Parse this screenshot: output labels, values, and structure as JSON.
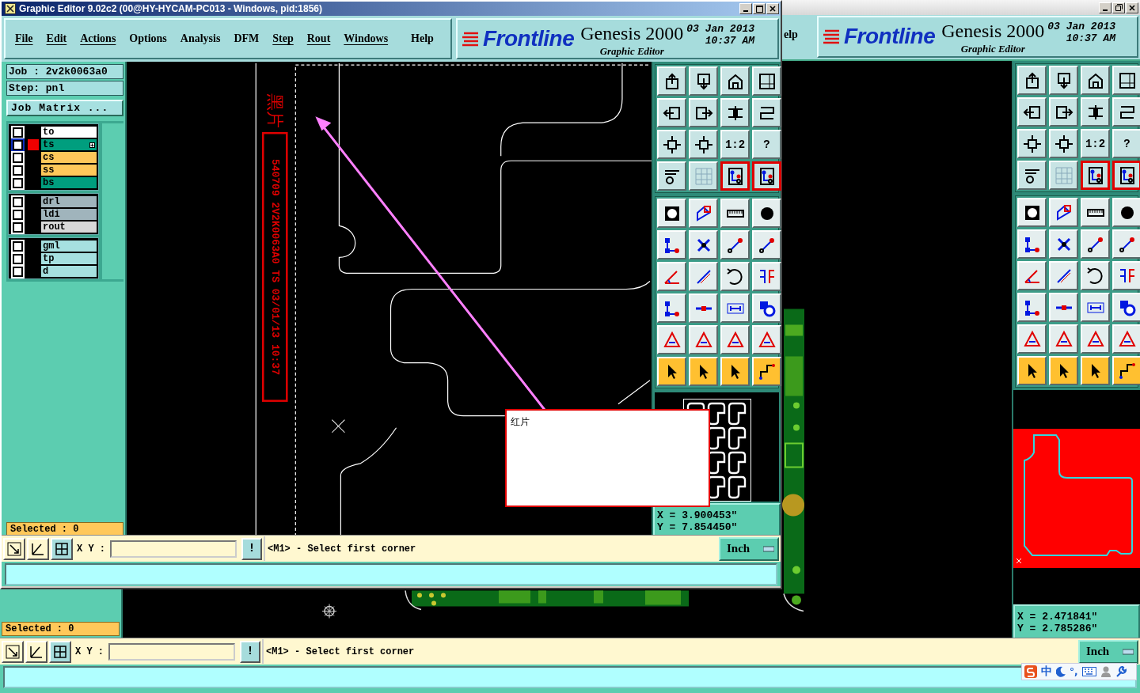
{
  "back_window": {
    "menu_fragment": "elp",
    "logo": {
      "brand": "Frontline",
      "product": "Genesis 2000",
      "subtitle": "Graphic Editor",
      "date": "03 Jan 2013",
      "time": "10:37 AM"
    },
    "toolbar": [
      {
        "kind": "view",
        "selected": false
      },
      {
        "kind": "view",
        "selected": false
      },
      {
        "kind": "view",
        "selected": false
      },
      {
        "kind": "view",
        "selected": false
      },
      {
        "kind": "view",
        "selected": false
      },
      {
        "kind": "view",
        "selected": false
      },
      {
        "kind": "view",
        "selected": false
      },
      {
        "kind": "view",
        "selected": false
      },
      {
        "kind": "view",
        "selected": false
      },
      {
        "kind": "view",
        "selected": false
      },
      {
        "kind": "view",
        "selected": false,
        "label": "1:2"
      },
      {
        "kind": "view",
        "selected": false,
        "label": "?"
      },
      {
        "kind": "view",
        "selected": false
      },
      {
        "kind": "view",
        "selected": false
      },
      {
        "kind": "view",
        "selected": true
      },
      {
        "kind": "view",
        "selected": true
      },
      {
        "kind": "edit",
        "selected": false
      },
      {
        "kind": "edit",
        "selected": false
      },
      {
        "kind": "edit",
        "selected": false
      },
      {
        "kind": "edit",
        "selected": false
      },
      {
        "kind": "edit",
        "selected": false
      },
      {
        "kind": "edit",
        "selected": false
      },
      {
        "kind": "edit",
        "selected": false
      },
      {
        "kind": "edit",
        "selected": false
      },
      {
        "kind": "edit",
        "selected": false
      },
      {
        "kind": "edit",
        "selected": false
      },
      {
        "kind": "edit",
        "selected": false
      },
      {
        "kind": "edit",
        "selected": false
      },
      {
        "kind": "edit",
        "selected": false
      },
      {
        "kind": "edit",
        "selected": false
      },
      {
        "kind": "edit",
        "selected": false
      },
      {
        "kind": "edit",
        "selected": false
      },
      {
        "kind": "edit",
        "selected": false
      },
      {
        "kind": "edit",
        "selected": false
      },
      {
        "kind": "edit",
        "selected": false
      },
      {
        "kind": "edit",
        "selected": false
      },
      {
        "kind": "select",
        "selected": false
      },
      {
        "kind": "select",
        "selected": false
      },
      {
        "kind": "select",
        "selected": false
      },
      {
        "kind": "select",
        "selected": false
      }
    ],
    "coordinates": {
      "x": "X = 2.471841\"",
      "y": "Y = 2.785286\""
    },
    "selected_count": "Selected : 0",
    "command_bar": {
      "xy_label": "X Y :",
      "alert": "!",
      "prompt": "<M1> - Select first corner",
      "units": "Inch"
    }
  },
  "front_window": {
    "title": "Graphic Editor 9.02c2 (00@HY-HYCAM-PC013 - Windows, pid:1856)",
    "menu": [
      {
        "label": "File",
        "underlined": true
      },
      {
        "label": "Edit",
        "underlined": true
      },
      {
        "label": "Actions",
        "underlined": true
      },
      {
        "label": "Options",
        "underlined": false
      },
      {
        "label": "Analysis",
        "underlined": false
      },
      {
        "label": "DFM",
        "underlined": false
      },
      {
        "label": "Step",
        "underlined": true
      },
      {
        "label": "Rout",
        "underlined": true
      },
      {
        "label": "Windows",
        "underlined": true
      },
      {
        "label": "Help",
        "underlined": false
      }
    ],
    "logo": {
      "brand": "Frontline",
      "product": "Genesis 2000",
      "subtitle": "Graphic Editor",
      "date": "03 Jan 2013",
      "time": "10:37 AM"
    },
    "job": "Job : 2v2k0063a0",
    "step": "Step: pnl",
    "job_matrix_button": "Job Matrix ...",
    "layer_groups": [
      {
        "layers": [
          {
            "name": "to",
            "color": "#ffffff",
            "checked": false,
            "active": false
          },
          {
            "name": "ts",
            "color": "#009e7e",
            "checked": false,
            "active": true
          },
          {
            "name": "cs",
            "color": "#ffc85a",
            "checked": false,
            "active": false
          },
          {
            "name": "ss",
            "color": "#ffc85a",
            "checked": false,
            "active": false
          },
          {
            "name": "bs",
            "color": "#009e7e",
            "checked": false,
            "active": false
          }
        ]
      },
      {
        "layers": [
          {
            "name": "drl",
            "color": "#a0b4bc",
            "checked": false,
            "active": false
          },
          {
            "name": "ldi",
            "color": "#a0b4bc",
            "checked": false,
            "active": false
          },
          {
            "name": "rout",
            "color": "#d8d8d8",
            "checked": false,
            "active": false
          }
        ]
      },
      {
        "layers": [
          {
            "name": "gml",
            "color": "#a6e0e0",
            "checked": false,
            "active": false
          },
          {
            "name": "tp",
            "color": "#a6e0e0",
            "checked": false,
            "active": false
          },
          {
            "name": "d",
            "color": "#a6e0e0",
            "checked": false,
            "active": false
          }
        ]
      }
    ],
    "selected_count": "Selected : 0",
    "canvas": {
      "marking_title": "黑片",
      "marking": "540709 2V2K0063A0 TS 03/01/13 10:37"
    },
    "popup": {
      "text": "红片"
    },
    "toolbar": [
      {
        "kind": "view",
        "selected": false
      },
      {
        "kind": "view",
        "selected": false
      },
      {
        "kind": "view",
        "selected": false
      },
      {
        "kind": "view",
        "selected": false
      },
      {
        "kind": "view",
        "selected": false
      },
      {
        "kind": "view",
        "selected": false
      },
      {
        "kind": "view",
        "selected": false
      },
      {
        "kind": "view",
        "selected": false
      },
      {
        "kind": "view",
        "selected": false
      },
      {
        "kind": "view",
        "selected": false
      },
      {
        "kind": "view",
        "selected": false,
        "label": "1:2"
      },
      {
        "kind": "view",
        "selected": false,
        "label": "?"
      },
      {
        "kind": "view",
        "selected": false
      },
      {
        "kind": "view",
        "selected": false
      },
      {
        "kind": "view",
        "selected": true
      },
      {
        "kind": "view",
        "selected": true
      },
      {
        "kind": "edit",
        "selected": false
      },
      {
        "kind": "edit",
        "selected": false
      },
      {
        "kind": "edit",
        "selected": false
      },
      {
        "kind": "edit",
        "selected": false
      },
      {
        "kind": "edit",
        "selected": false
      },
      {
        "kind": "edit",
        "selected": false
      },
      {
        "kind": "edit",
        "selected": false
      },
      {
        "kind": "edit",
        "selected": false
      },
      {
        "kind": "edit",
        "selected": false
      },
      {
        "kind": "edit",
        "selected": false
      },
      {
        "kind": "edit",
        "selected": false
      },
      {
        "kind": "edit",
        "selected": false
      },
      {
        "kind": "edit",
        "selected": false
      },
      {
        "kind": "edit",
        "selected": false
      },
      {
        "kind": "edit",
        "selected": false
      },
      {
        "kind": "edit",
        "selected": false
      },
      {
        "kind": "edit",
        "selected": false
      },
      {
        "kind": "edit",
        "selected": false
      },
      {
        "kind": "edit",
        "selected": false
      },
      {
        "kind": "edit",
        "selected": false
      },
      {
        "kind": "select",
        "selected": false
      },
      {
        "kind": "select",
        "selected": false
      },
      {
        "kind": "select",
        "selected": false
      },
      {
        "kind": "select",
        "selected": false
      }
    ],
    "coordinates": {
      "x": "X = 3.900453\"",
      "y": "Y = 7.854450\""
    },
    "command_bar": {
      "xy_label": "X Y :",
      "alert": "!",
      "prompt": "<M1> - Select first corner",
      "units": "Inch"
    }
  },
  "ime_bar": {
    "mode": "中",
    "punctuation": "°,"
  }
}
